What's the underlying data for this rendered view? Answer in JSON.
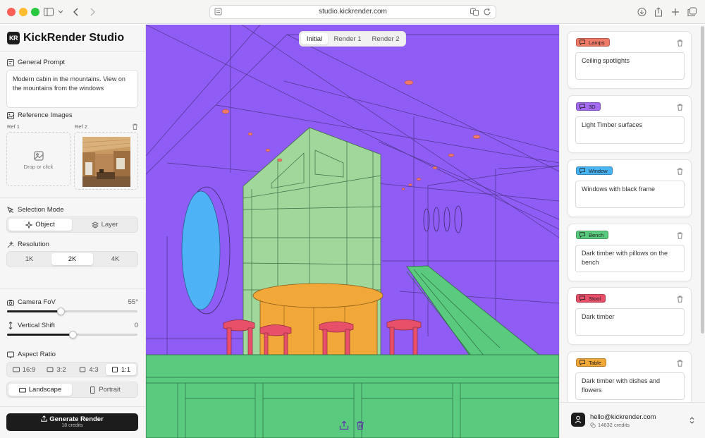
{
  "browser": {
    "url": "studio.kickrender.com"
  },
  "app": {
    "logo_text": "KR",
    "title": "KickRender Studio"
  },
  "sidebar": {
    "general_prompt": {
      "label": "General Prompt",
      "value": "Modern cabin in the mountains. View on the mountains from the windows"
    },
    "reference_images": {
      "label": "Reference Images",
      "ref1_label": "Ref 1",
      "ref2_label": "Ref 2",
      "drop_text": "Drop or click"
    },
    "selection_mode": {
      "label": "Selection Mode",
      "options": [
        "Object",
        "Layer"
      ],
      "selected": "Object"
    },
    "resolution": {
      "label": "Resolution",
      "options": [
        "1K",
        "2K",
        "4K"
      ],
      "selected": "2K"
    },
    "camera_fov": {
      "label": "Camera FoV",
      "value_text": "55°",
      "fraction": 0.41
    },
    "vertical_shift": {
      "label": "Vertical Shift",
      "value_text": "0",
      "fraction": 0.5
    },
    "aspect_ratio": {
      "label": "Aspect Ratio",
      "ratios": [
        "16:9",
        "3:2",
        "4:3",
        "1:1"
      ],
      "selected_ratio": "1:1",
      "orientations": [
        "Landscape",
        "Portrait"
      ],
      "selected_orientation": "Landscape"
    },
    "generate": {
      "label": "Generate Render",
      "credits": "18 credits"
    }
  },
  "canvas": {
    "tabs": [
      "Initial",
      "Render 1",
      "Render 2"
    ],
    "active_tab": "Initial"
  },
  "layers": [
    {
      "name": "Lamps",
      "color": "#f07a68",
      "prompt": "Ceiling spotlights"
    },
    {
      "name": "3D",
      "color": "#a46bf2",
      "prompt": "Light Timber surfaces"
    },
    {
      "name": "Window",
      "color": "#48b4f4",
      "prompt": "Windows with black frame"
    },
    {
      "name": "Bench",
      "color": "#5acb7e",
      "prompt": "Dark timber with pillows on the bench"
    },
    {
      "name": "Stool",
      "color": "#e8506a",
      "prompt": "Dark timber"
    },
    {
      "name": "Table",
      "color": "#f2a838",
      "prompt": "Dark timber with dishes and flowers"
    }
  ],
  "account": {
    "email": "hello@kickrender.com",
    "credits": "14632 credits"
  }
}
